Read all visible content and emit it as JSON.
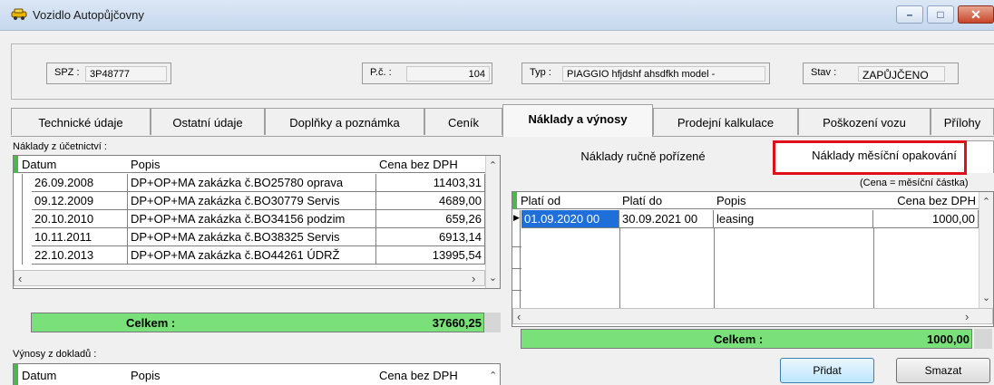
{
  "window": {
    "title": "Vozidlo Autopůjčovny",
    "controls": {
      "minimize": "–",
      "maximize": "□",
      "close": "✕"
    }
  },
  "header": {
    "spz_label": "SPZ :",
    "spz_value": "3P48777",
    "pc_label": "P.č. :",
    "pc_value": "104",
    "typ_label": "Typ :",
    "typ_value": "PIAGGIO hfjdshf ahsdfkh model -",
    "stav_label": "Stav :",
    "stav_value": "ZAPŮJČENO"
  },
  "tabs": [
    {
      "label": "Technické údaje"
    },
    {
      "label": "Ostatní údaje"
    },
    {
      "label": "Doplňky a poznámka"
    },
    {
      "label": "Ceník"
    },
    {
      "label": "Náklady a výnosy"
    },
    {
      "label": "Prodejní kalkulace"
    },
    {
      "label": "Poškození vozu"
    },
    {
      "label": "Přílohy"
    }
  ],
  "active_tab": "Náklady a výnosy",
  "costs_accounting": {
    "section_label": "Náklady z účetnictví :",
    "columns": [
      "Datum",
      "Popis",
      "Cena bez DPH"
    ],
    "rows": [
      [
        "26.09.2008",
        "DP+OP+MA zakázka č.BO25780 oprava",
        "11403,31"
      ],
      [
        "09.12.2009",
        "DP+OP+MA zakázka č.BO30779 Servis",
        "4689,00"
      ],
      [
        "20.10.2010",
        "DP+OP+MA zakázka č.BO34156 podzim",
        "659,26"
      ],
      [
        "10.11.2011",
        "DP+OP+MA zakázka č.BO38325 Servis",
        "6913,14"
      ],
      [
        "22.10.2013",
        "DP+OP+MA zakázka č.BO44261 ÚDRŽ",
        "13995,54"
      ]
    ],
    "total_label": "Celkem :",
    "total_value": "37660,25"
  },
  "revenues": {
    "section_label": "Výnosy z dokladů :",
    "columns": [
      "Datum",
      "Popis",
      "Cena bez DPH"
    ]
  },
  "subtabs": [
    {
      "label": "Náklady ručně pořízené"
    },
    {
      "label": "Náklady měsíční opakování"
    }
  ],
  "monthly_costs": {
    "note": "(Cena = měsíční částka)",
    "columns": [
      "Platí od",
      "Platí do",
      "Popis",
      "Cena bez DPH"
    ],
    "rows": [
      [
        "01.09.2020 00",
        "30.09.2021 00",
        "leasing",
        "1000,00"
      ]
    ],
    "total_label": "Celkem :",
    "total_value": "1000,00"
  },
  "buttons": {
    "add_label": "Přidat",
    "delete_label": "Smazat"
  },
  "colors": {
    "total_green": "#7ae07a",
    "highlight_red": "#e0101a",
    "selection_blue": "#1e6fd9"
  }
}
